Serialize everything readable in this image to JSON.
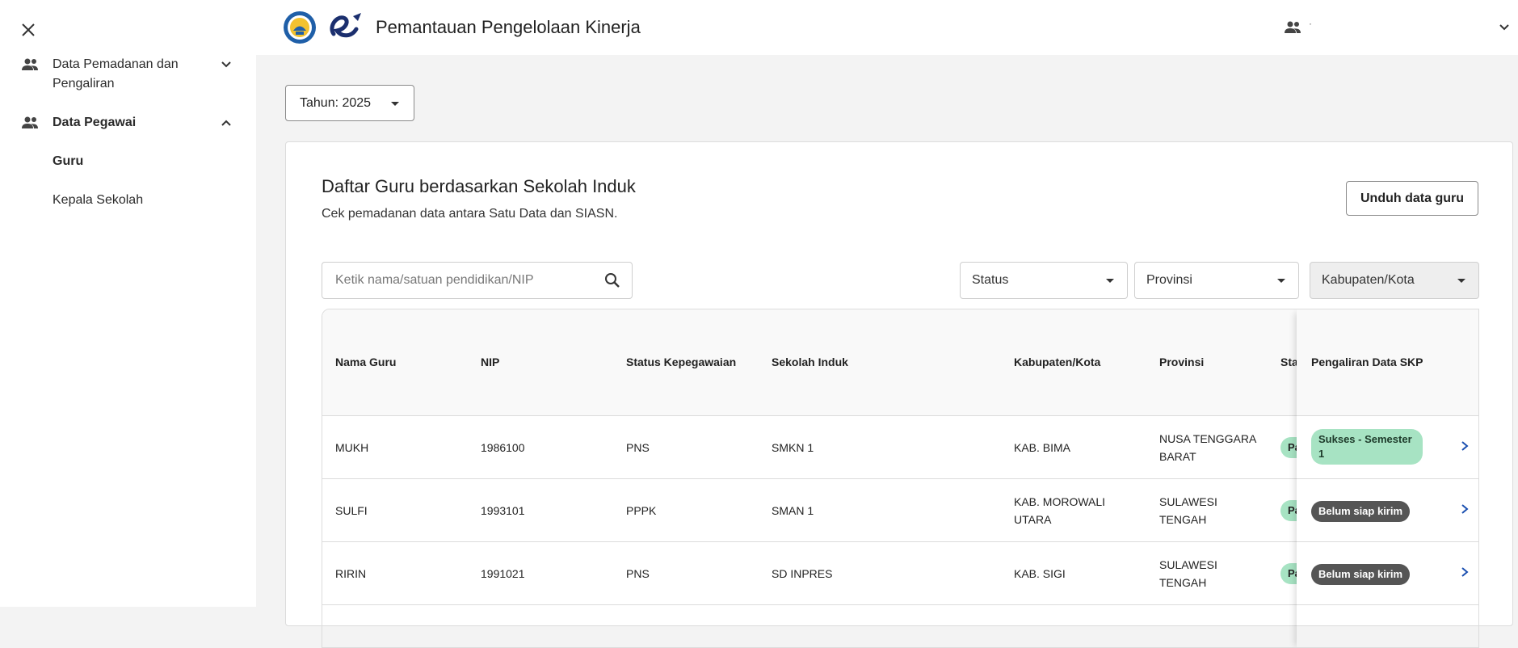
{
  "sidebar": {
    "items": [
      {
        "label": "Data Pemadanan dan Pengaliran",
        "expanded": false
      },
      {
        "label": "Data Pegawai",
        "expanded": true,
        "children": [
          {
            "label": "Guru",
            "active": true
          },
          {
            "label": "Kepala Sekolah",
            "active": false
          }
        ]
      }
    ]
  },
  "header": {
    "title": "Pemantauan Pengelolaan Kinerja",
    "user_name": "·"
  },
  "year_select": {
    "label": "Tahun: 2025"
  },
  "card": {
    "title": "Daftar Guru berdasarkan Sekolah Induk",
    "subtitle": "Cek pemadanan data antara Satu Data dan SIASN.",
    "download_label": "Unduh data guru"
  },
  "search": {
    "placeholder": "Ketik nama/satuan pendidikan/NIP"
  },
  "filters": {
    "status": "Status",
    "provinsi": "Provinsi",
    "kabupaten": "Kabupaten/Kota"
  },
  "table": {
    "headers": {
      "nama": "Nama Guru",
      "nip": "NIP",
      "status_kepegawaian": "Status Kepegawaian",
      "sekolah": "Sekolah Induk",
      "kabupaten": "Kabupaten/Kota",
      "provinsi": "Provinsi",
      "status_partial": "Stat",
      "pengaliran": "Pengaliran Data SKP"
    },
    "rows": [
      {
        "nama": "MUKH",
        "nip": "1986100",
        "status_kepegawaian": "PNS",
        "sekolah": "SMKN 1",
        "kabupaten": "KAB. BIMA",
        "provinsi": "NUSA TENGGARA BARAT",
        "status_partial": "Pa",
        "pengaliran": "Sukses - Semester 1",
        "pengaliran_type": "success"
      },
      {
        "nama": "SULFI",
        "nip": "1993101",
        "status_kepegawaian": "PPPK",
        "sekolah": "SMAN 1",
        "kabupaten": "KAB. MOROWALI UTARA",
        "provinsi": "SULAWESI TENGAH",
        "status_partial": "Pa",
        "pengaliran": "Belum siap kirim",
        "pengaliran_type": "pending"
      },
      {
        "nama": "RIRIN",
        "nip": "1991021",
        "status_kepegawaian": "PNS",
        "sekolah": "SD INPRES",
        "kabupaten": "KAB. SIGI",
        "provinsi": "SULAWESI TENGAH",
        "status_partial": "Pa",
        "pengaliran": "Belum siap kirim",
        "pengaliran_type": "pending"
      }
    ]
  },
  "colors": {
    "accent_blue": "#1a4fb0",
    "success_badge": "#a7e3c3",
    "pending_badge": "#555555"
  },
  "icons": [
    "close-icon",
    "people-icon",
    "chevron-down-icon",
    "chevron-up-icon",
    "search-icon",
    "chevron-right-icon",
    "kemdikbud-logo",
    "e-kinerja-logo"
  ]
}
